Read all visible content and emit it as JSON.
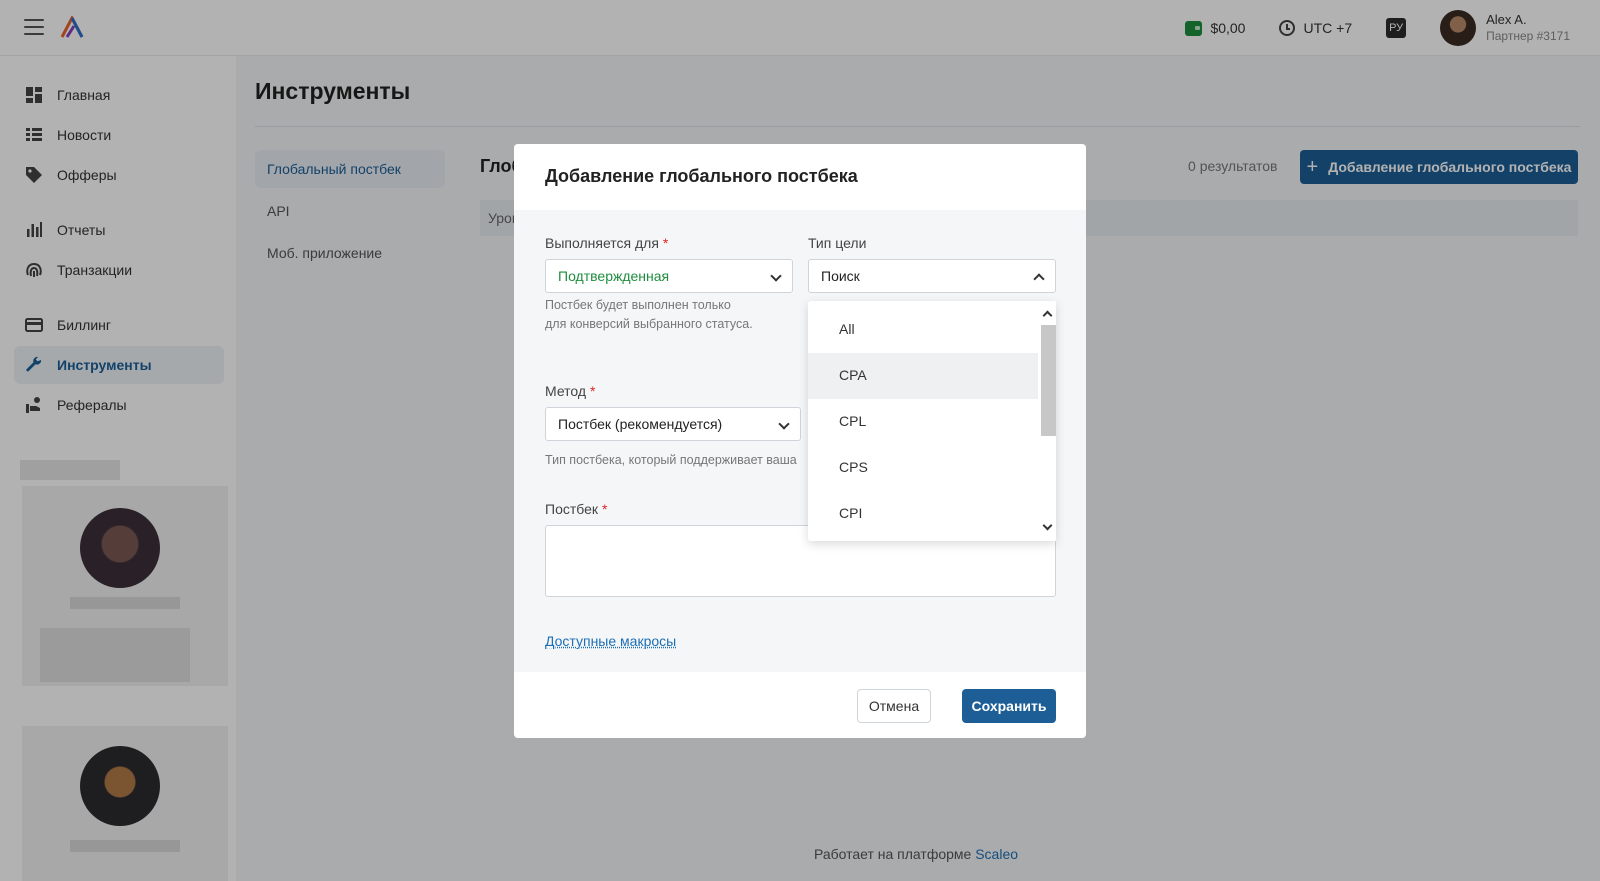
{
  "topbar": {
    "balance": "$0,00",
    "timezone": "UTC +7",
    "language": "РУ",
    "user_name": "Alex A.",
    "user_sub": "Партнер #3171"
  },
  "sidebar": {
    "items": [
      {
        "label": "Главная",
        "icon": "dashboard-icon"
      },
      {
        "label": "Новости",
        "icon": "news-icon"
      },
      {
        "label": "Офферы",
        "icon": "tag-icon"
      },
      {
        "label": "Отчеты",
        "icon": "bar-chart-icon"
      },
      {
        "label": "Транзакции",
        "icon": "fingerprint-icon"
      },
      {
        "label": "Биллинг",
        "icon": "credit-card-icon"
      },
      {
        "label": "Инструменты",
        "icon": "wrench-icon",
        "active": true
      },
      {
        "label": "Рефералы",
        "icon": "referral-icon"
      }
    ]
  },
  "main": {
    "title": "Инструменты",
    "subnav": [
      "Глобальный постбек",
      "API",
      "Моб. приложение"
    ],
    "section_title": "Глоб",
    "results_count": "0",
    "results_label": "результатов",
    "add_button": "Добавление глобального постбека",
    "table_header": "Уров"
  },
  "modal": {
    "title": "Добавление глобального постбека",
    "status_label": "Выполняется для",
    "status_value": "Подтвержденная",
    "status_help": "Постбек будет выполнен только для конверсий выбранного статуса.",
    "goal_type_label": "Тип цели",
    "goal_type_placeholder": "Поиск",
    "method_label": "Метод",
    "method_value": "Постбек (рекомендуется)",
    "method_help": "Тип постбека, который поддерживает ваша",
    "postback_label": "Постбек",
    "macros_link": "Доступные макросы",
    "cancel": "Отмена",
    "save": "Сохранить",
    "goal_options": [
      "All",
      "CPA",
      "CPL",
      "CPS",
      "CPI"
    ]
  },
  "footer": {
    "text": "Работает на платформе",
    "link": "Scaleo"
  },
  "colors": {
    "accent": "#1d5e96",
    "success": "#1e8e3e",
    "required": "#e02424"
  }
}
